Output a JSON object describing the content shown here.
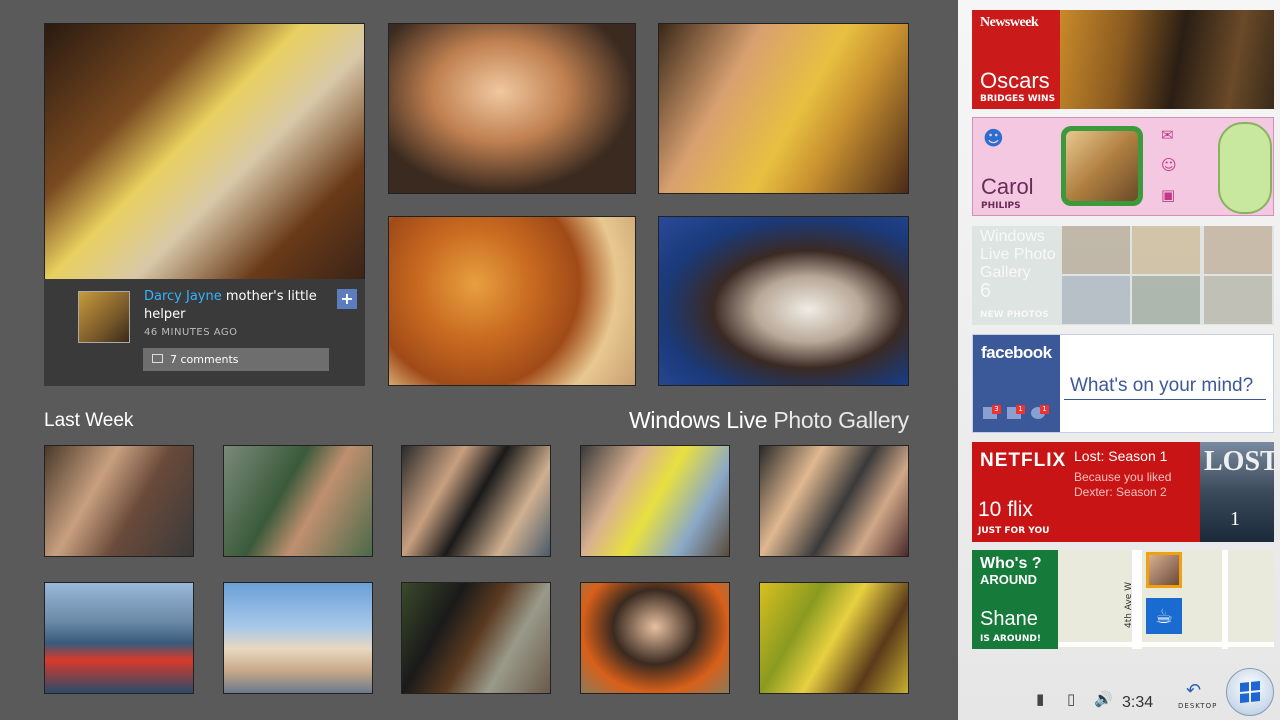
{
  "gallery": {
    "caption": {
      "author": "Darcy Jayne",
      "text": " mother's little helper",
      "time": "46 MINUTES AGO",
      "comments": "7 comments"
    },
    "section_title": "Last Week",
    "brand_bold": "Windows Live",
    "brand_light": " Photo Gallery"
  },
  "tiles": {
    "newsweek": {
      "masthead": "Newsweek",
      "title": "Oscars",
      "subtitle": "BRIDGES WINS"
    },
    "messenger": {
      "name": "Carol",
      "subtitle": "PHILIPS"
    },
    "photo_gallery": {
      "title": "Windows Live Photo Gallery",
      "count": "6",
      "subtitle": "NEW PHOTOS"
    },
    "facebook": {
      "logo": "facebook",
      "prompt": "What's on your mind?",
      "badges": [
        "3",
        "1",
        "1"
      ]
    },
    "netflix": {
      "logo": "NETFLIX",
      "title": "Lost: Season 1",
      "because_line1": "Because you liked",
      "because_line2": "Dexter: Season 2",
      "count": "10 flix",
      "subtitle": "JUST FOR YOU",
      "poster_title": "LOST",
      "poster_number": "1"
    },
    "whos_around": {
      "title_line1": "Who's ?",
      "title_line2": "AROUND",
      "name": "Shane",
      "subtitle": "IS AROUND!",
      "street": "4th Ave W"
    }
  },
  "taskbar": {
    "time": "3:34",
    "desktop_label": "DESKTOP"
  }
}
